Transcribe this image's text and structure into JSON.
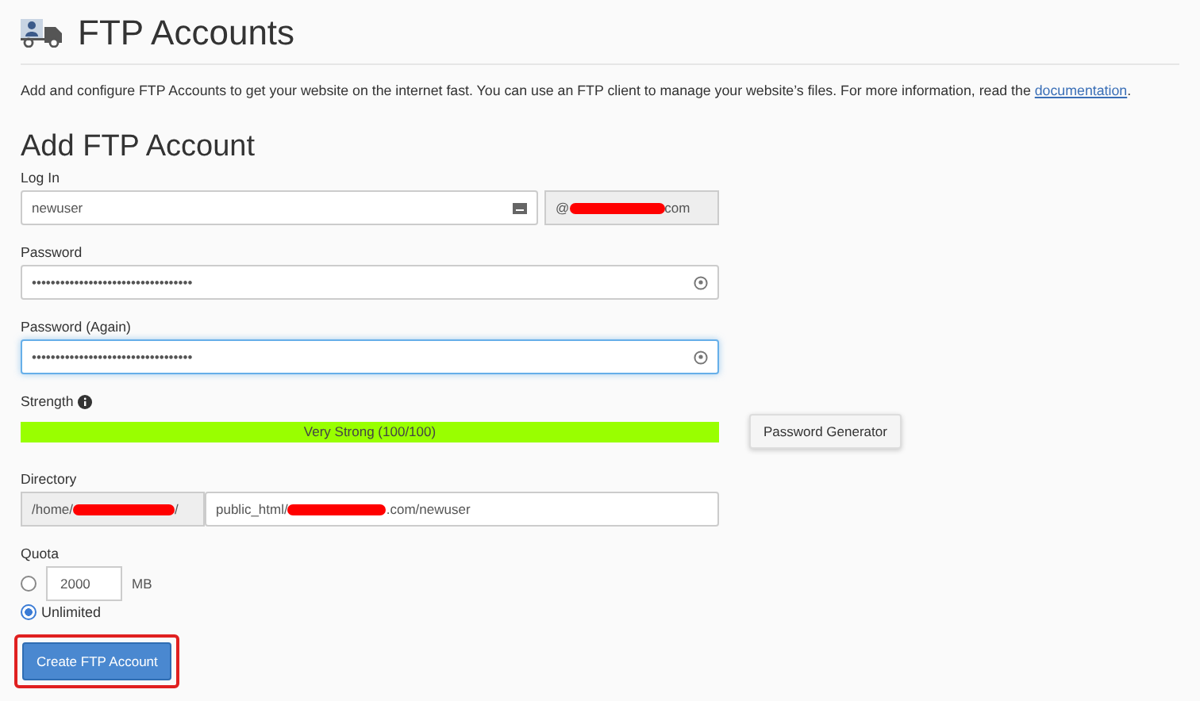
{
  "header": {
    "title": "FTP Accounts"
  },
  "intro": {
    "text": "Add and configure FTP Accounts to get your website on the internet fast. You can use an FTP client to manage your website’s files. For more information, read the",
    "link": "documentation",
    "after": "."
  },
  "form": {
    "title": "Add FTP Account",
    "login": {
      "label": "Log In",
      "value": "newuser",
      "domain_prefix": "@",
      "domain_suffix": "com"
    },
    "password": {
      "label": "Password",
      "value": "••••••••••••••••••••••••••••••••••",
      "focused": false
    },
    "password_again": {
      "label": "Password (Again)",
      "value": "••••••••••••••••••••••••••••••••••",
      "focused": true
    },
    "strength": {
      "label": "Strength",
      "level": 1,
      "reading": "Very Strong (100/100)",
      "generator_button": "Password Generator"
    },
    "directory": {
      "label": "Directory",
      "prefix_start": "/home/",
      "prefix_end": "/",
      "value_start": "public_html/",
      "value_end": ".com/newuser"
    },
    "quota": {
      "label": "Quota",
      "options": [
        {
          "kind": "limited",
          "selected": false,
          "value": "2000",
          "unit": "MB"
        },
        {
          "kind": "unlimited",
          "selected": true,
          "label": "Unlimited"
        }
      ]
    },
    "submit": {
      "label": "Create FTP Account",
      "highlighted": true
    }
  }
}
